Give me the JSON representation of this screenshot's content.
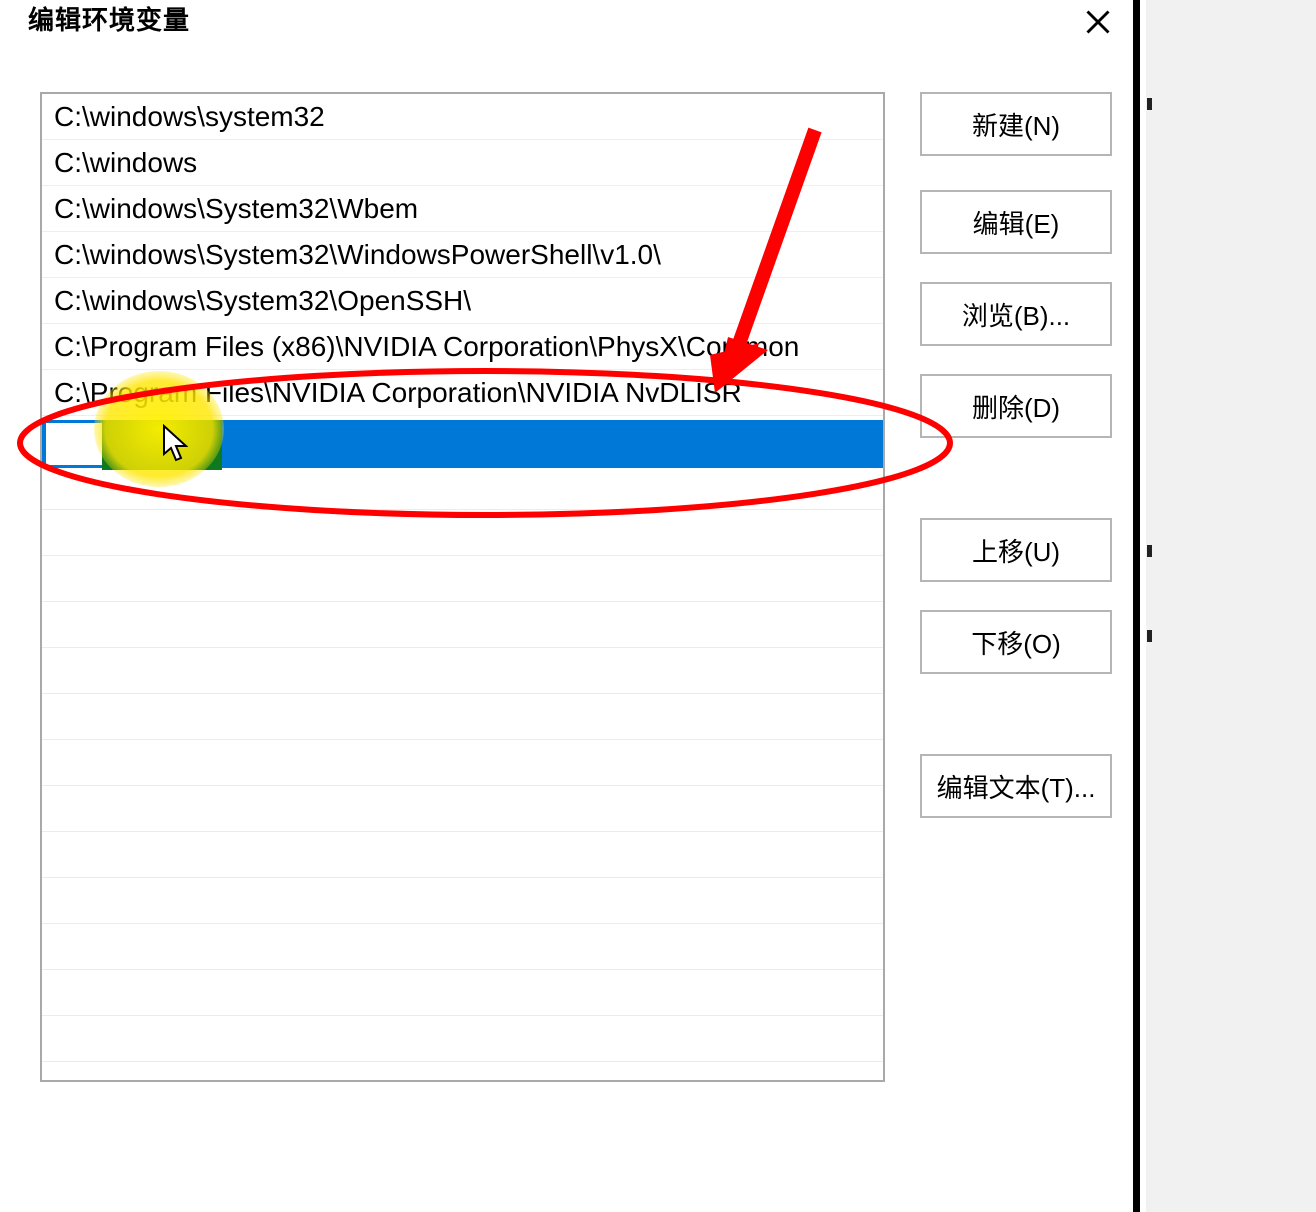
{
  "title": "编辑环境变量",
  "paths": [
    "C:\\windows\\system32",
    "C:\\windows",
    "C:\\windows\\System32\\Wbem",
    "C:\\windows\\System32\\WindowsPowerShell\\v1.0\\",
    "C:\\windows\\System32\\OpenSSH\\",
    "C:\\Program Files (x86)\\NVIDIA Corporation\\PhysX\\Common",
    "C:\\Program Files\\NVIDIA Corporation\\NVIDIA NvDLISR"
  ],
  "selected_value": "",
  "buttons": {
    "new": "新建(N)",
    "edit": "编辑(E)",
    "browse": "浏览(B)...",
    "delete": "删除(D)",
    "moveup": "上移(U)",
    "movedown": "下移(O)",
    "edittext": "编辑文本(T)..."
  }
}
